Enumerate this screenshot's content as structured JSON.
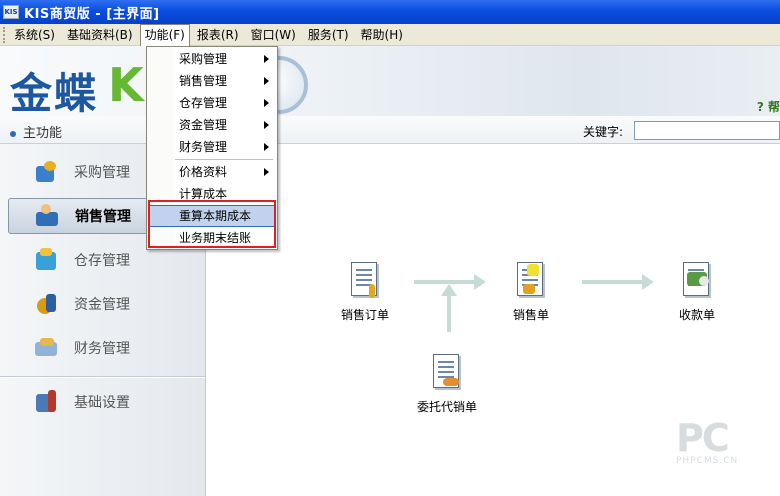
{
  "window": {
    "icon_text": "KIS",
    "title": "KIS商贸版 - [主界面]"
  },
  "menubar": {
    "items": [
      {
        "label": "系统(S)"
      },
      {
        "label": "基础资料(B)"
      },
      {
        "label": "功能(F)"
      },
      {
        "label": "报表(R)"
      },
      {
        "label": "窗口(W)"
      },
      {
        "label": "服务(T)"
      },
      {
        "label": "帮助(H)"
      }
    ]
  },
  "banner": {
    "logo_text": "金蝶",
    "logo_k": "K",
    "help_text": "? 帮"
  },
  "searchbar": {
    "main_label": "主功能",
    "keyword_label": "关键字:",
    "keyword_value": ""
  },
  "sidebar": {
    "items": [
      {
        "label": "采购管理",
        "icon": "purchase-icon"
      },
      {
        "label": "销售管理",
        "icon": "sales-icon",
        "selected": true
      },
      {
        "label": "仓存管理",
        "icon": "warehouse-icon"
      },
      {
        "label": "资金管理",
        "icon": "money-icon"
      },
      {
        "label": "财务管理",
        "icon": "finance-icon"
      },
      {
        "label": "基础设置",
        "icon": "settings-icon"
      }
    ]
  },
  "dropdown": {
    "items": [
      {
        "label": "采购管理",
        "submenu": true
      },
      {
        "label": "销售管理",
        "submenu": true
      },
      {
        "label": "仓存管理",
        "submenu": true
      },
      {
        "label": "资金管理",
        "submenu": true
      },
      {
        "label": "财务管理",
        "submenu": true
      },
      {
        "label": "价格资料",
        "submenu": true
      },
      {
        "label": "计算成本",
        "submenu": false
      },
      {
        "label": "重算本期成本",
        "submenu": false,
        "highlighted": true
      },
      {
        "label": "业务期末结账",
        "submenu": false
      }
    ]
  },
  "flow": {
    "nodes": [
      {
        "label": "销售订单",
        "icon": "sales-order-icon"
      },
      {
        "label": "销售单",
        "icon": "sales-doc-icon"
      },
      {
        "label": "收款单",
        "icon": "receipt-icon"
      },
      {
        "label": "委托代销单",
        "icon": "consignment-icon"
      }
    ]
  },
  "watermark": {
    "big": "PC",
    "small": "PHPCMS.CN"
  },
  "colors": {
    "titlebar": "#0a4de0",
    "accent_blue": "#1d57a0",
    "accent_green": "#66b832",
    "highlight_frame": "#e02020"
  }
}
